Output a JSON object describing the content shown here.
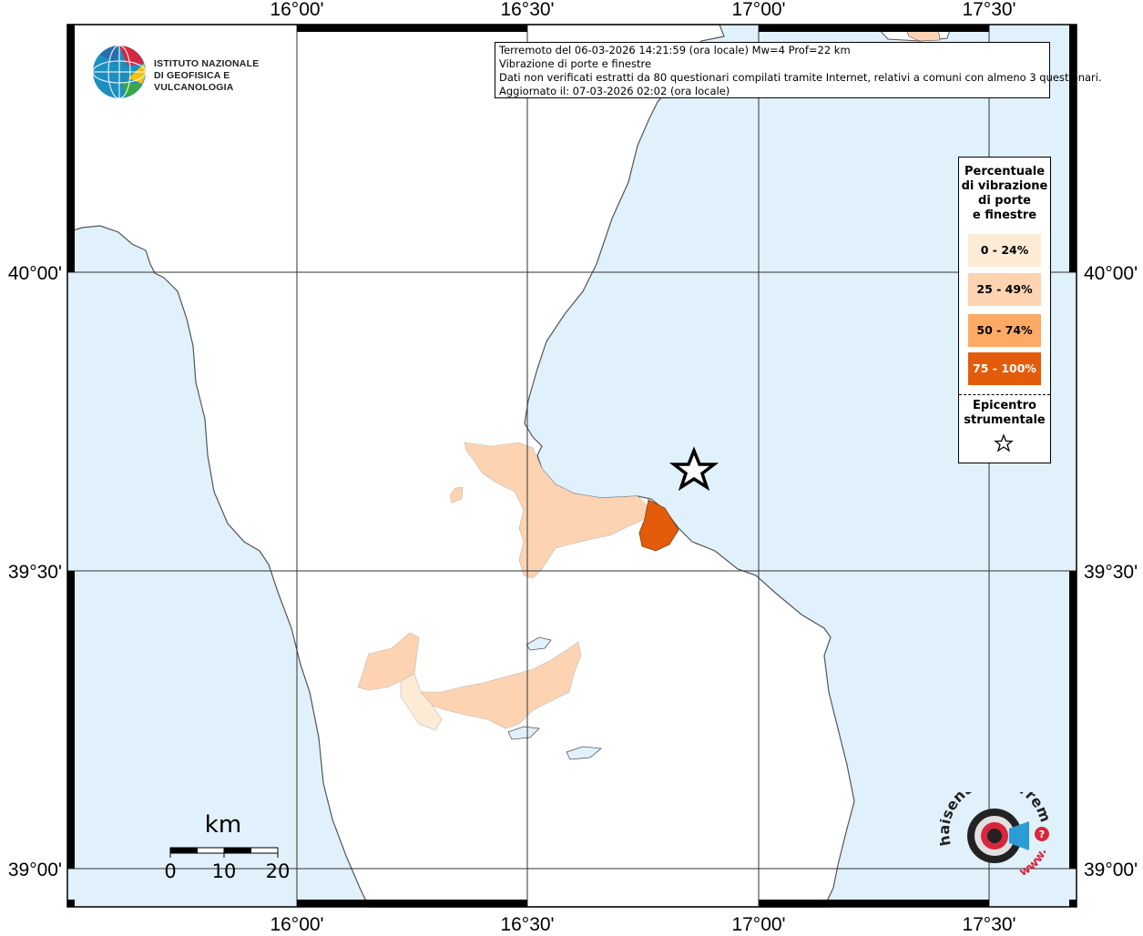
{
  "map": {
    "lon_labels": [
      "16°00'",
      "16°30'",
      "17°00'",
      "17°30'"
    ],
    "lat_labels": [
      "40°00'",
      "39°30'",
      "39°00'"
    ],
    "colors": {
      "sea": "#e0f1fc",
      "land": "#ffffff",
      "class_0_24": "#fdebd6",
      "class_25_49": "#fdd3b2",
      "class_50_74": "#fdaa66",
      "class_75_100": "#e25c0b"
    }
  },
  "info": {
    "line1": "Terremoto del 06-03-2026 14:21:59 (ora locale) Mw=4 Prof=22 km",
    "line2": "Vibrazione di porte e finestre",
    "line3": "Dati non verificati estratti da 80 questionari compilati tramite Internet, relativi a comuni con almeno 3 questionari.",
    "line4": "Aggiornato il: 07-03-2026 02:02 (ora locale)"
  },
  "legend": {
    "title_line1": "Percentuale",
    "title_line2": "di vibrazione",
    "title_line3": "di porte",
    "title_line4": "e finestre",
    "items": [
      {
        "label": "0 - 24%",
        "color": "#fdebd6"
      },
      {
        "label": "25 - 49%",
        "color": "#fdd3b2"
      },
      {
        "label": "50 - 74%",
        "color": "#fdaa66"
      },
      {
        "label": "75 - 100%",
        "color": "#e25c0b"
      }
    ],
    "epicenter_line1": "Epicentro",
    "epicenter_line2": "strumentale"
  },
  "logo": {
    "line1": "ISTITUTO NAZIONALE",
    "line2": "DI GEOFISICA E VULCANOLOGIA"
  },
  "hst_logo": {
    "text_top": "haisentitoilterremoto.it",
    "text_bottom": "www."
  },
  "scale_bar": {
    "unit": "km",
    "labels": [
      "0",
      "10",
      "20"
    ]
  }
}
